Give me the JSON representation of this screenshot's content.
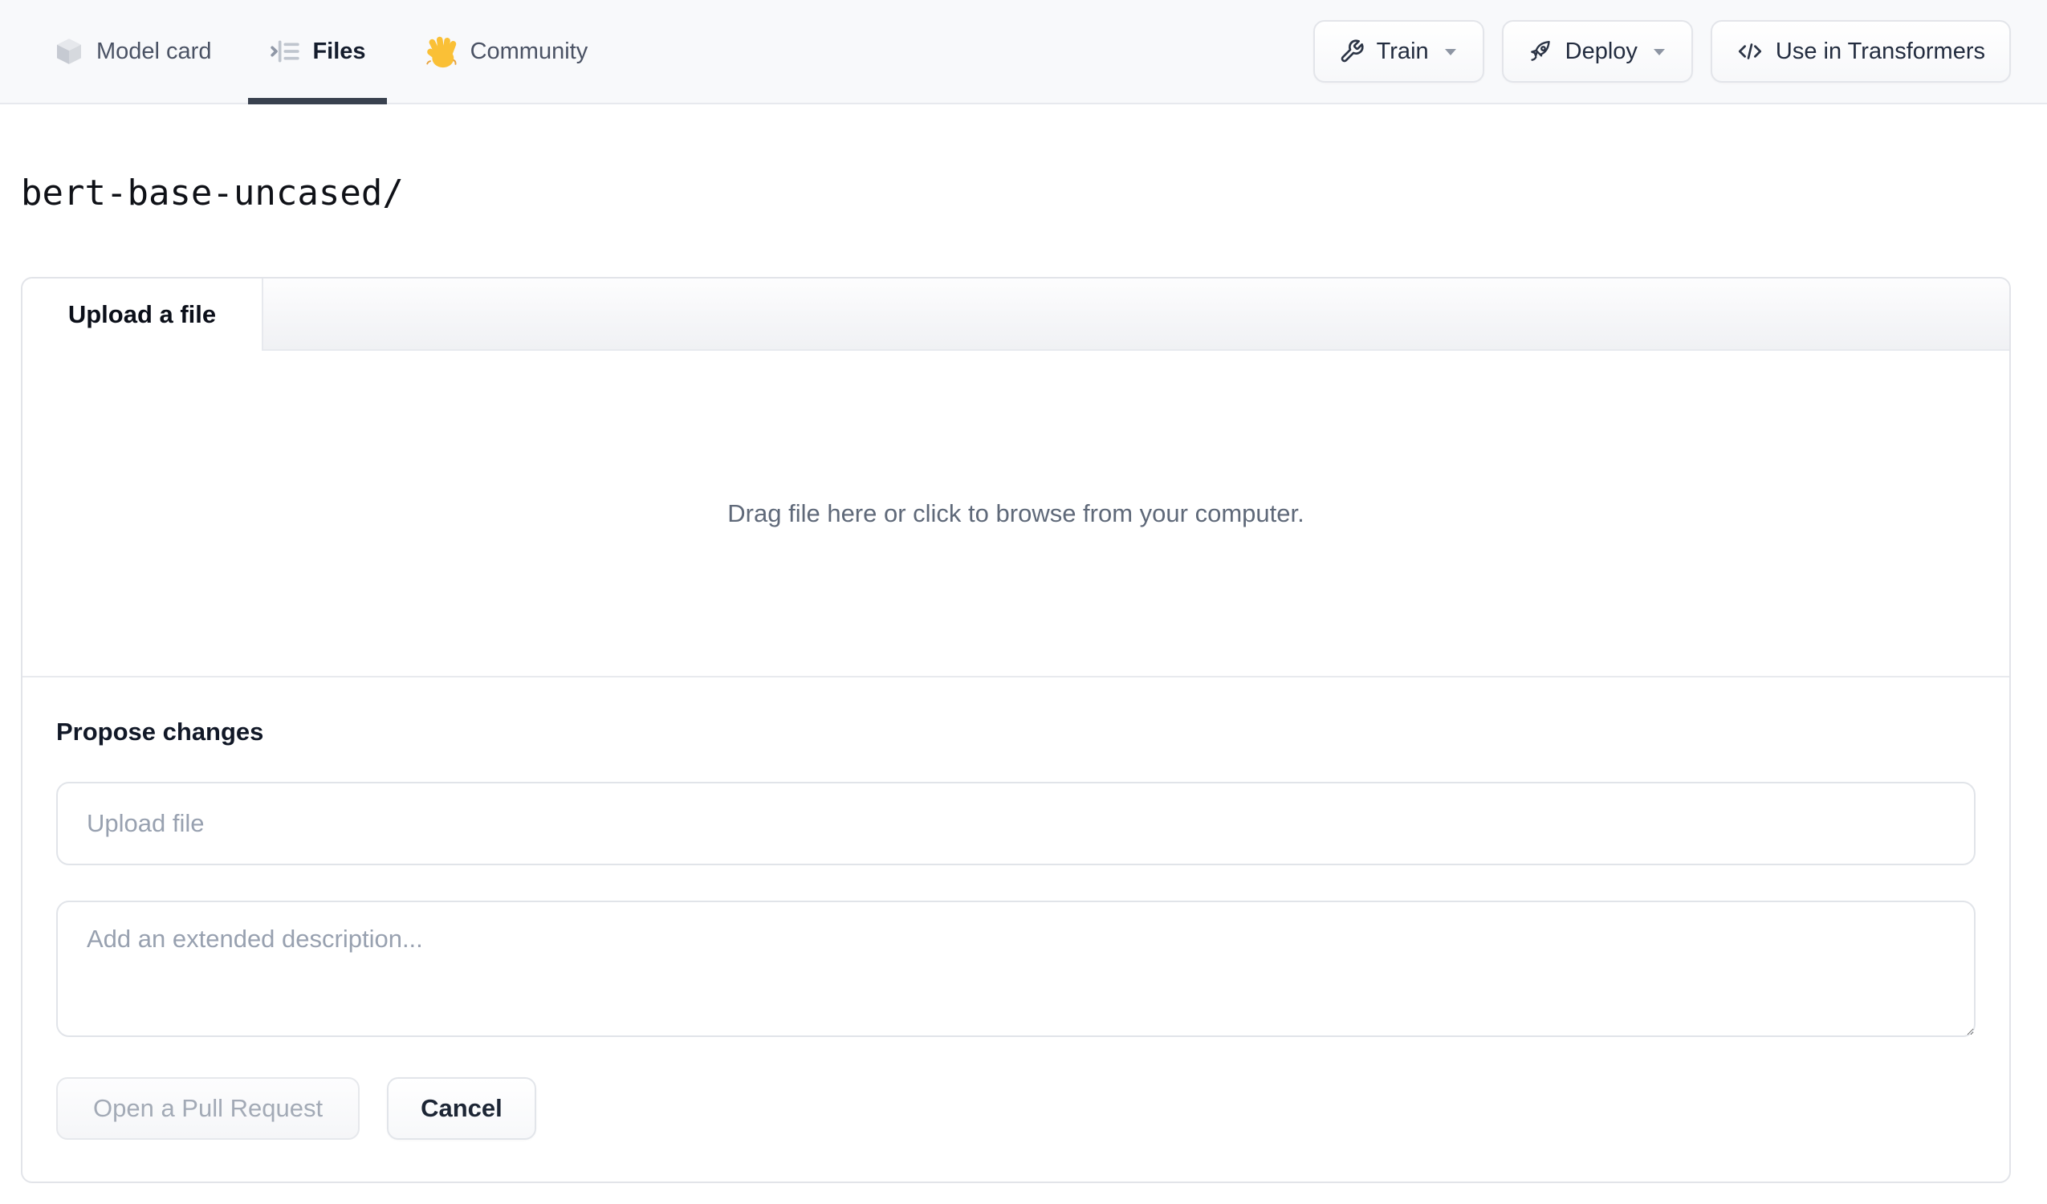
{
  "header": {
    "tabs": [
      {
        "id": "model-card",
        "label": "Model card",
        "icon": "cube-icon",
        "active": false
      },
      {
        "id": "files",
        "label": "Files",
        "icon": "files-list-icon",
        "active": true
      },
      {
        "id": "community",
        "label": "Community",
        "icon": "waving-hand-icon",
        "active": false
      }
    ],
    "actions": {
      "train_label": "Train",
      "deploy_label": "Deploy",
      "use_in_transformers_label": "Use in Transformers"
    }
  },
  "breadcrumb": {
    "repo_path": "bert-base-uncased/"
  },
  "upload_card": {
    "tab_label": "Upload a file",
    "dropzone_text": "Drag file here or click to browse from your computer.",
    "propose": {
      "heading": "Propose changes",
      "filename_placeholder": "Upload file",
      "description_placeholder": "Add an extended description...",
      "submit_label": "Open a Pull Request",
      "submit_disabled": true,
      "cancel_label": "Cancel"
    }
  },
  "colors": {
    "header_background": "#f8f9fb",
    "active_tab_underline": "#39414f",
    "border": "#e2e4e9",
    "muted_text": "#5f6979",
    "placeholder_text": "#98a1b0",
    "disabled_text": "#a3aab6",
    "dark_text": "#111827",
    "hand_emoji_yellow": "#fac036"
  }
}
